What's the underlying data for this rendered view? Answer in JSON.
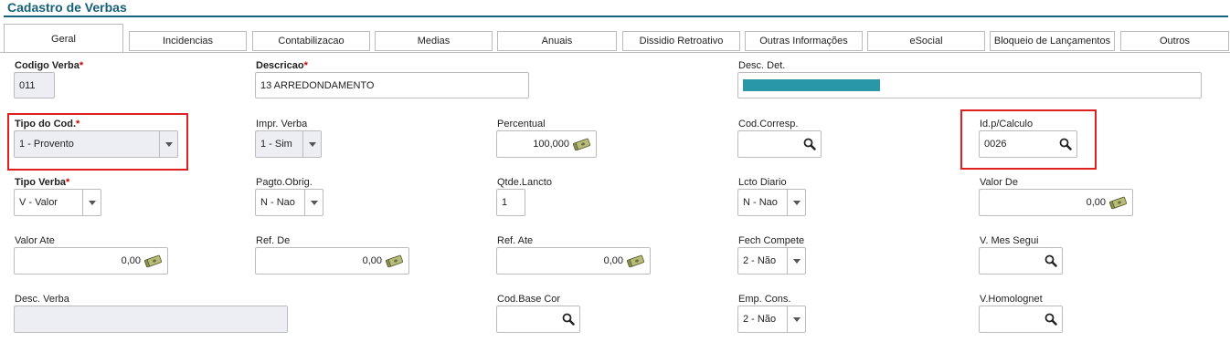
{
  "page": {
    "title": "Cadastro de Verbas"
  },
  "tabs": [
    {
      "label": "Geral",
      "active": true
    },
    {
      "label": "Incidencias"
    },
    {
      "label": "Contabilizacao"
    },
    {
      "label": "Medias"
    },
    {
      "label": "Anuais"
    },
    {
      "label": "Dissidio Retroativo"
    },
    {
      "label": "Outras Informações"
    },
    {
      "label": "eSocial"
    },
    {
      "label": "Bloqueio de Lançamentos"
    },
    {
      "label": "Outros"
    }
  ],
  "form": {
    "codigo_verba": {
      "label": "Codigo Verba",
      "value": "011"
    },
    "descricao": {
      "label": "Descricao",
      "value": "13 ARREDONDAMENTO"
    },
    "desc_det": {
      "label": "Desc. Det.",
      "highlight_color": "#2a97a8"
    },
    "tipo_cod": {
      "label": "Tipo do Cod.",
      "value": "1 - Provento"
    },
    "impr_verba": {
      "label": "Impr. Verba",
      "value": "1 - Sim"
    },
    "percentual": {
      "label": "Percentual",
      "value": "100,000"
    },
    "cod_corresp": {
      "label": "Cod.Corresp.",
      "value": ""
    },
    "id_calculo": {
      "label": "Id.p/Calculo",
      "value": "0026"
    },
    "tipo_verba": {
      "label": "Tipo Verba",
      "value": "V - Valor"
    },
    "pagto_obrig": {
      "label": "Pagto.Obrig.",
      "value": "N - Nao"
    },
    "qtde_lancto": {
      "label": "Qtde.Lancto",
      "value": "1"
    },
    "lcto_diario": {
      "label": "Lcto Diario",
      "value": "N - Nao"
    },
    "valor_de": {
      "label": "Valor De",
      "value": "0,00"
    },
    "valor_ate": {
      "label": "Valor Ate",
      "value": "0,00"
    },
    "ref_de": {
      "label": "Ref. De",
      "value": "0,00"
    },
    "ref_ate": {
      "label": "Ref. Ate",
      "value": "0,00"
    },
    "fech_compete": {
      "label": "Fech Compete",
      "value": "2 - Não"
    },
    "v_mes_segui": {
      "label": "V. Mes Segui",
      "value": ""
    },
    "desc_verba": {
      "label": "Desc. Verba",
      "value": ""
    },
    "cod_base_cor": {
      "label": "Cod.Base Cor",
      "value": ""
    },
    "emp_cons": {
      "label": "Emp. Cons.",
      "value": "2 - Não"
    },
    "v_homolognet": {
      "label": "V.Homolognet",
      "value": ""
    }
  },
  "colors": {
    "accent": "#16607a",
    "required": "#cc0000",
    "highlight_box": "#e02020"
  }
}
